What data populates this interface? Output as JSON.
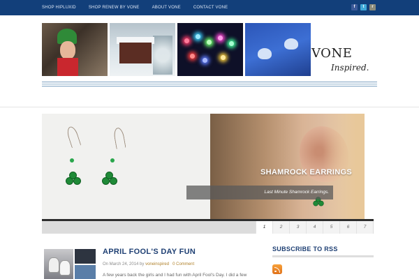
{
  "nav": {
    "items": [
      "SHOP HIPLUXID",
      "SHOP RENEW BY VONE",
      "ABOUT VONE",
      "CONTACT VONE"
    ]
  },
  "social": {
    "icons": [
      "facebook-icon",
      "twitter-icon",
      "rss-icon"
    ],
    "glyphs": [
      "f",
      "t",
      "r"
    ],
    "colors": {
      "facebook": "#3b5998",
      "twitter": "#3fa9d7",
      "rss": "#8a8a7a"
    }
  },
  "logo": {
    "main": "VONE",
    "sub": "Inspired."
  },
  "slider": {
    "title": "SHAMROCK EARRINGS",
    "caption": "Last Minute Shamrock Earrings.",
    "pages": [
      "1",
      "2",
      "3",
      "4",
      "5",
      "6",
      "7"
    ],
    "active_page": "1"
  },
  "post": {
    "title": "APRIL FOOL'S DAY FUN",
    "date": "On March 24, 2014",
    "by": "by",
    "author": "voneinspired",
    "comments": "0 Comment",
    "excerpt": "A few years back the girls and I had fun with April Fool's Day. I did a few"
  },
  "sidebar": {
    "widget_title": "SUBSCRIBE TO RSS"
  },
  "colors": {
    "topbar": "#123f7a",
    "accent_title": "#1e3f73",
    "meta_link": "#b0822c"
  }
}
